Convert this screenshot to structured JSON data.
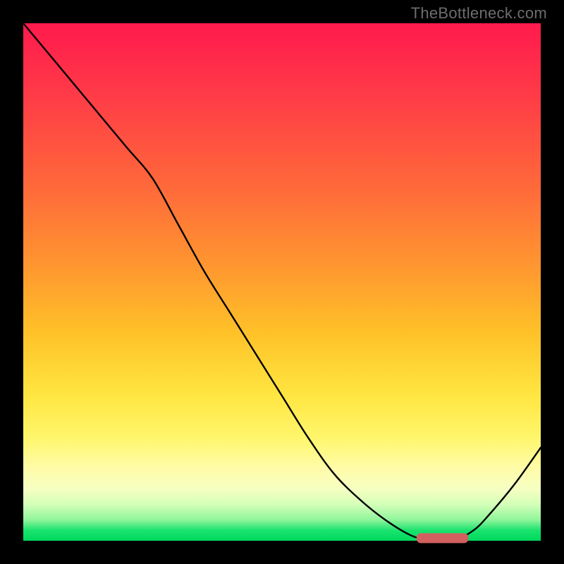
{
  "watermark": "TheBottleneck.com",
  "colors": {
    "frame": "#000000",
    "curve": "#000000",
    "marker": "#d26060",
    "gradient_top": "#ff1a4d",
    "gradient_bottom": "#00d85c"
  },
  "chart_data": {
    "type": "line",
    "title": "",
    "xlabel": "",
    "ylabel": "",
    "xlim": [
      0,
      100
    ],
    "ylim": [
      0,
      100
    ],
    "x": [
      0,
      5,
      10,
      15,
      20,
      25,
      30,
      35,
      40,
      45,
      50,
      55,
      60,
      65,
      70,
      75,
      79,
      83,
      87,
      90,
      95,
      100
    ],
    "values": [
      100,
      94,
      88,
      82,
      76,
      70,
      61,
      52,
      44,
      36,
      28,
      20,
      13,
      8,
      4,
      1,
      0,
      0,
      2,
      5,
      11,
      18
    ],
    "marker_range_x": [
      76,
      86
    ],
    "marker_y": 0.5,
    "legend": null
  }
}
